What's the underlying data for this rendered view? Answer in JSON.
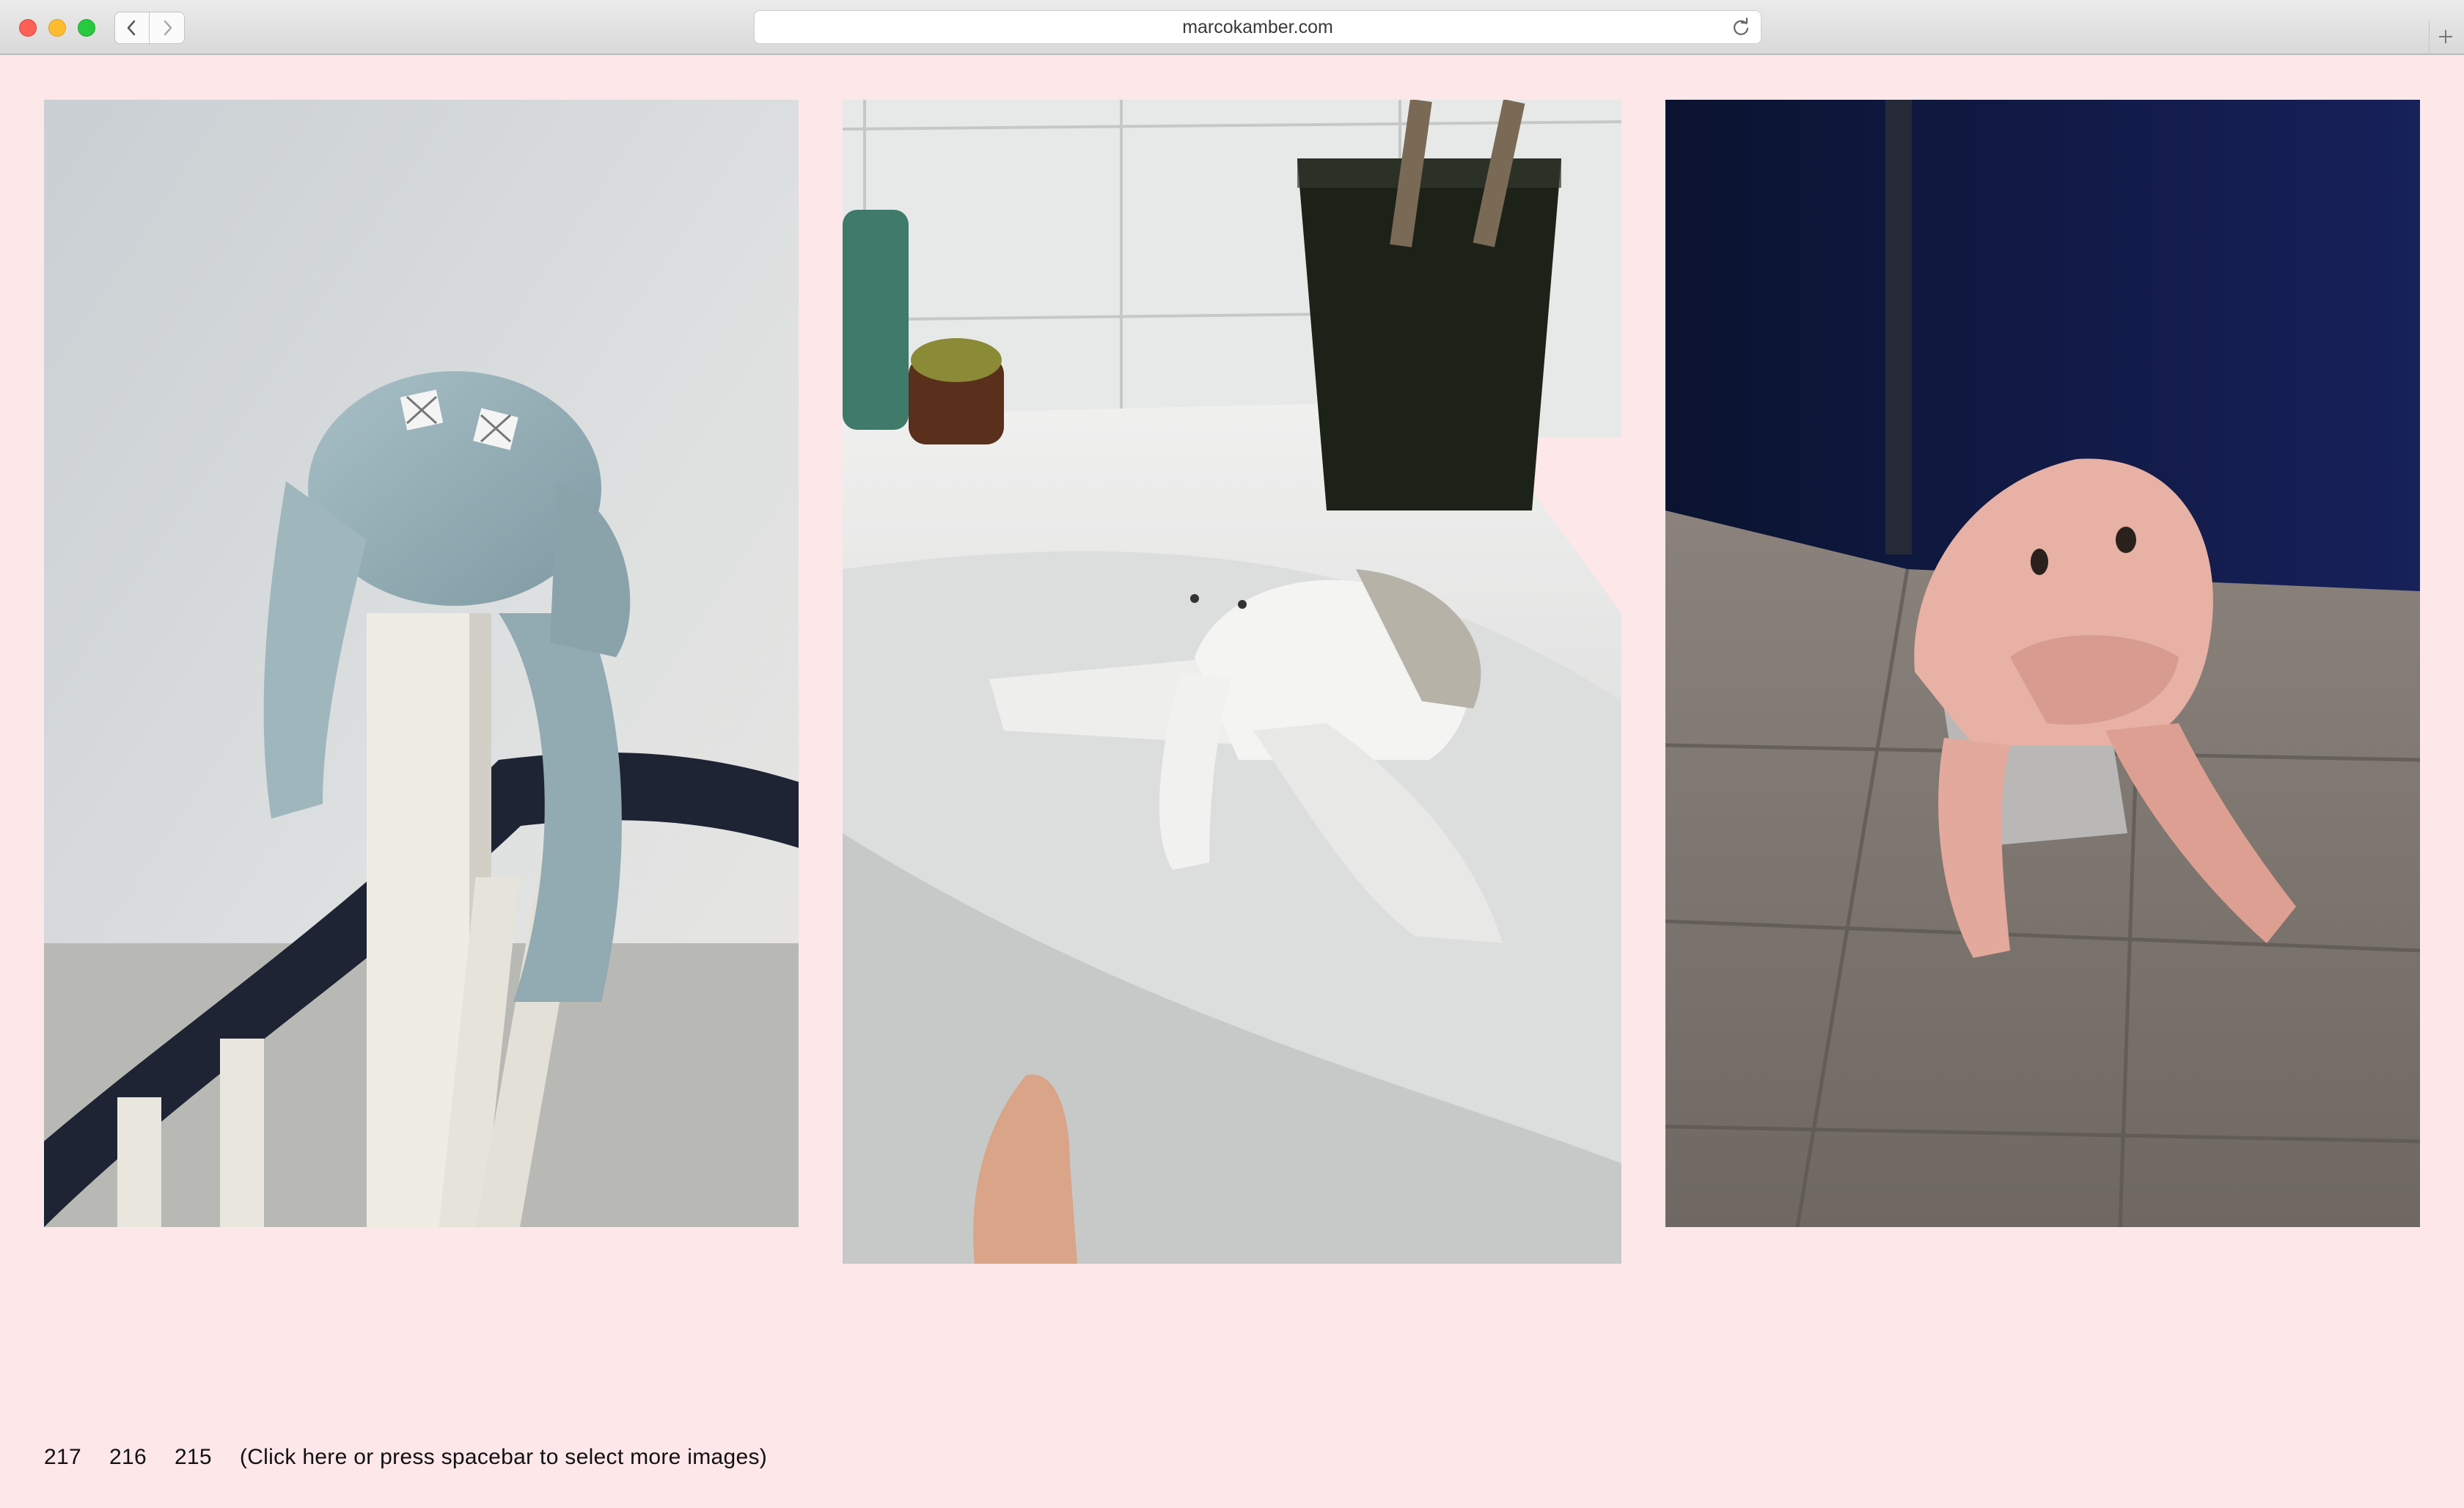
{
  "browser": {
    "url": "marcokamber.com"
  },
  "icons": {
    "back": "chevron-left-icon",
    "forward": "chevron-right-icon",
    "reload": "reload-icon",
    "new_tab": "plus-icon"
  },
  "colors": {
    "page_background": "#fde7e9",
    "text": "#111111"
  },
  "gallery": {
    "images": [
      {
        "subject": "blue-gray towel animal draped over a white stair newel post"
      },
      {
        "subject": "white towel animal on the rim of a bathtub"
      },
      {
        "subject": "pink towel animal on a tiled floor in front of a blue door"
      }
    ]
  },
  "footer": {
    "numbers": [
      "217",
      "216",
      "215"
    ],
    "more_link": "(Click here or press spacebar to select more images)"
  }
}
